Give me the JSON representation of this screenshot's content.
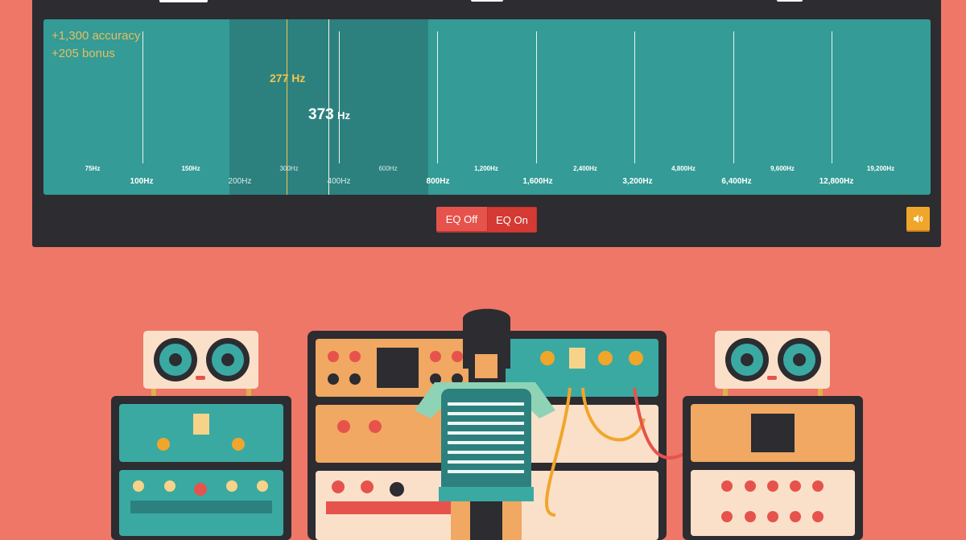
{
  "panel": {
    "score": {
      "accuracy": "+1,300 accuracy",
      "bonus": "+205 bonus"
    },
    "guess_label": {
      "value": "277",
      "unit": "Hz"
    },
    "answer_label": {
      "value": "373",
      "unit": "Hz"
    },
    "minor_ticks": [
      "75Hz",
      "150Hz",
      "300Hz",
      "600Hz",
      "1,200Hz",
      "2,400Hz",
      "4,800Hz",
      "9,600Hz",
      "19,200Hz"
    ],
    "major_ticks": [
      "100Hz",
      "200Hz",
      "400Hz",
      "800Hz",
      "1,600Hz",
      "3,200Hz",
      "6,400Hz",
      "12,800Hz"
    ]
  },
  "eq": {
    "off_label": "EQ Off",
    "on_label": "EQ On",
    "active": "on"
  },
  "volume": {
    "icon": "speaker-icon"
  },
  "colors": {
    "background": "#ee7767",
    "panel": "#2c2c31",
    "frequency_area": "#349b96",
    "selected_band": "#2c817f",
    "guess_marker": "#f2c14e",
    "eq_button": "#e6534c",
    "volume_button": "#f0a62a"
  }
}
